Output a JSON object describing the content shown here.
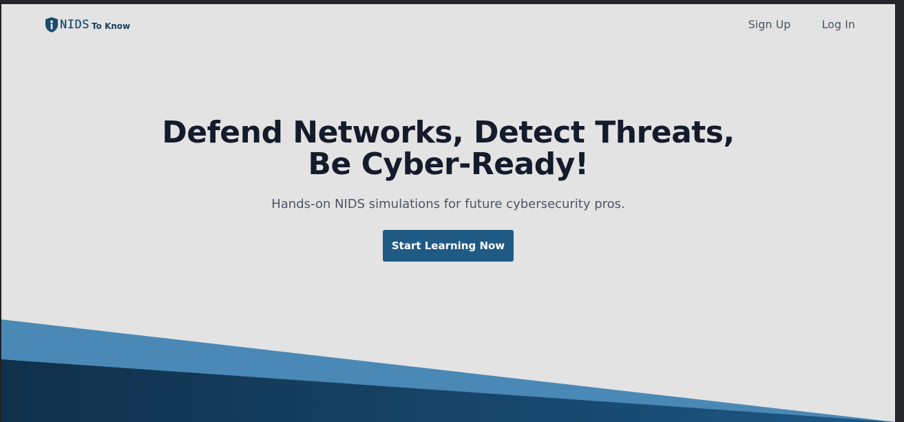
{
  "header": {
    "logo_text": "NIDS",
    "logo_subtext": "To Know",
    "nav": {
      "sign_up": "Sign Up",
      "log_in": "Log In"
    }
  },
  "hero": {
    "title_line1": "Defend Networks, Detect Threats,",
    "title_line2": "Be Cyber-Ready!",
    "subtitle": "Hands-on NIDS simulations for future cybersecurity pros.",
    "cta_label": "Start Learning Now"
  },
  "colors": {
    "background": "#e3e3e3",
    "primary": "#1f5a85",
    "light_blue": "#4a88b6",
    "dark_navy": "#10304a",
    "heading": "#141b2b",
    "muted_text": "#4b5565"
  }
}
